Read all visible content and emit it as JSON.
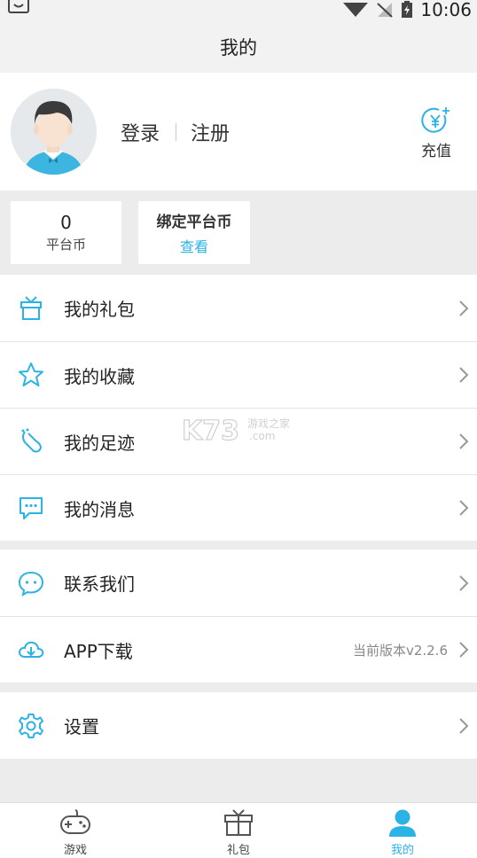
{
  "status_bar": {
    "time": "10:06",
    "icons": [
      "notification-icon",
      "wifi-icon",
      "no-signal-icon",
      "battery-charging-icon"
    ]
  },
  "header": {
    "title": "我的"
  },
  "profile": {
    "login_label": "登录",
    "register_label": "注册",
    "recharge_label": "充值",
    "recharge_icon": "yen-plus-icon"
  },
  "coins": {
    "platform_coin_value": "0",
    "platform_coin_label": "平台币",
    "bind_coin_label": "绑定平台币",
    "bind_coin_link": "查看"
  },
  "menu_group_1": [
    {
      "label": "我的礼包",
      "icon": "gift-icon"
    },
    {
      "label": "我的收藏",
      "icon": "star-icon"
    },
    {
      "label": "我的足迹",
      "icon": "footprint-icon"
    },
    {
      "label": "我的消息",
      "icon": "message-icon"
    }
  ],
  "menu_group_2": [
    {
      "label": "联系我们",
      "icon": "chat-bubble-icon"
    },
    {
      "label": "APP下载",
      "icon": "cloud-download-icon",
      "extra": "当前版本v2.2.6"
    }
  ],
  "menu_group_3": [
    {
      "label": "设置",
      "icon": "gear-icon"
    }
  ],
  "tabbar": [
    {
      "label": "游戏",
      "icon": "gamepad-icon",
      "active": false
    },
    {
      "label": "礼包",
      "icon": "gift-box-icon",
      "active": false
    },
    {
      "label": "我的",
      "icon": "user-icon",
      "active": true
    }
  ],
  "colors": {
    "accent": "#2bb3e6",
    "background": "#ececec",
    "text": "#222222"
  }
}
